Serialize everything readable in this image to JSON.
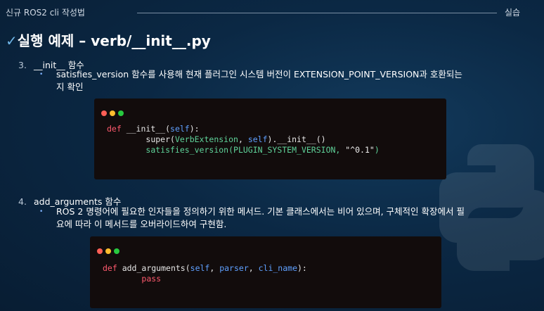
{
  "header": {
    "left_text": "신규 ROS2 cli 작성법",
    "right_text": "실습"
  },
  "title": {
    "check": "✓",
    "text": "실행 예제 – verb/__init__.py"
  },
  "items": [
    {
      "number": "3.",
      "heading": "__init__ 함수",
      "bullet": "satisfies_version 함수를 사용해 현재 플러그인 시스템 버전이 EXTENSION_POINT_VERSION과 호환되는 지 확인",
      "bullet_lines": [
        "satisfies_version 함수를 사용해 현재 플러그인 시스템 버전이 EXTENSION_POINT_VERSION과 호환되는",
        "지 확인"
      ],
      "code": {
        "line1": {
          "def": "def",
          "name": " __init__(",
          "self": "self",
          "end": "):"
        },
        "line2": {
          "indent": "        ",
          "a": "super(",
          "cls": "VerbExtension",
          "b": ", ",
          "self": "self",
          "c": ").__init__()"
        },
        "line3": {
          "indent": "        ",
          "fn": "satisfies_version(",
          "arg": "PLUGIN_SYSTEM_VERSION",
          "b": ", ",
          "str": "\"^0.1\"",
          "c": ")"
        }
      }
    },
    {
      "number": "4.",
      "heading": "add_arguments 함수",
      "bullet": "ROS 2 명령어에 필요한 인자들을 정의하기 위한 메서드. 기본 클래스에서는 비어 있으며, 구체적인 확장에서 필요에 따라 이 메서드를 오버라이드하여 구현함.",
      "bullet_lines": [
        "ROS 2 명령어에 필요한 인자들을 정의하기 위한 메서드. 기본 클래스에서는 비어 있으며, 구체적인 확장에서 필",
        "요에 따라 이 메서드를 오버라이드하여 구현함."
      ],
      "code": {
        "line1": {
          "def": "def",
          "name": " add_arguments(",
          "self": "self",
          "b": ", ",
          "p": "parser",
          "c": ", ",
          "cli": "cli_name",
          "end": "):"
        },
        "line2": {
          "indent": "        ",
          "kw": "pass"
        }
      }
    }
  ],
  "colors": {
    "background": "#0b2844",
    "keyword": "#ff5a6e",
    "self": "#5fa0ff",
    "green": "#5fd39a"
  },
  "icons": [
    "checkmark-icon",
    "window-dots-icon",
    "python-logo-watermark"
  ]
}
